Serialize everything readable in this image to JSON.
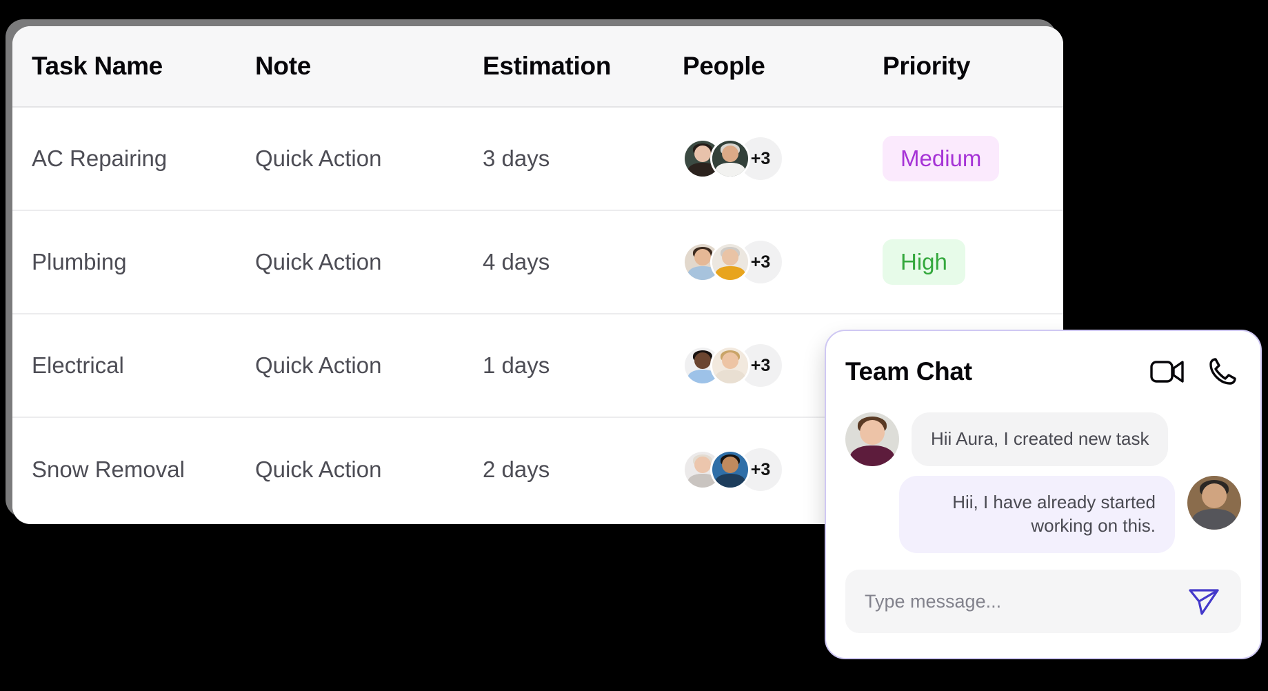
{
  "table": {
    "columns": [
      "Task Name",
      "Note",
      "Estimation",
      "People",
      "Priority"
    ],
    "rows": [
      {
        "task": "AC Repairing",
        "note": "Quick Action",
        "estimation": "3 days",
        "people_more": "+3",
        "priority": "Medium",
        "priority_style": "medium"
      },
      {
        "task": "Plumbing",
        "note": "Quick Action",
        "estimation": "4 days",
        "people_more": "+3",
        "priority": "High",
        "priority_style": "high"
      },
      {
        "task": "Electrical",
        "note": "Quick Action",
        "estimation": "1 days",
        "people_more": "+3",
        "priority": "",
        "priority_style": "none"
      },
      {
        "task": "Snow Removal",
        "note": "Quick Action",
        "estimation": "2 days",
        "people_more": "+3",
        "priority": "",
        "priority_style": "none"
      }
    ]
  },
  "chat": {
    "title": "Team Chat",
    "video_icon": "video-camera-icon",
    "call_icon": "phone-icon",
    "messages": [
      {
        "direction": "incoming",
        "text": "Hii Aura, I created new task"
      },
      {
        "direction": "outgoing",
        "text": "Hii, I have already started working on this."
      }
    ],
    "composer": {
      "placeholder": "Type message...",
      "value": "",
      "send_icon": "send-icon"
    }
  },
  "colors": {
    "badge_medium_bg": "#fbeafd",
    "badge_medium_fg": "#a633d6",
    "badge_high_bg": "#e7fbe9",
    "badge_high_fg": "#34a83d",
    "chat_border": "#cfc8f3",
    "send_accent": "#4338ca",
    "bubble_in": "#f3f3f4",
    "bubble_out": "#f3f0fd"
  }
}
